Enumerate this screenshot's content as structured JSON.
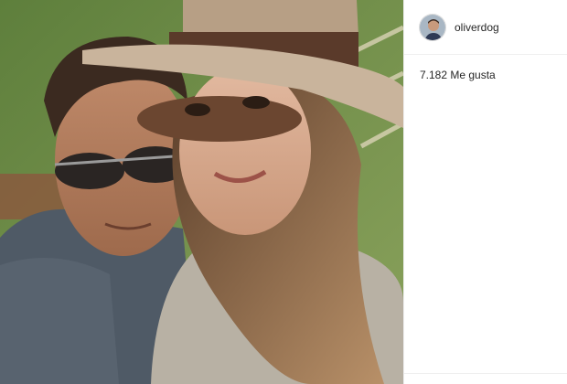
{
  "post": {
    "photo_alt": "selfie photo",
    "username": "oliverdog",
    "likes": "7.182 Me gusta",
    "comment_placeholder": ""
  },
  "icons": {
    "avatar": "profile-avatar"
  },
  "colors": {
    "text": "#262626",
    "divider": "#efefef",
    "background": "#ffffff"
  }
}
